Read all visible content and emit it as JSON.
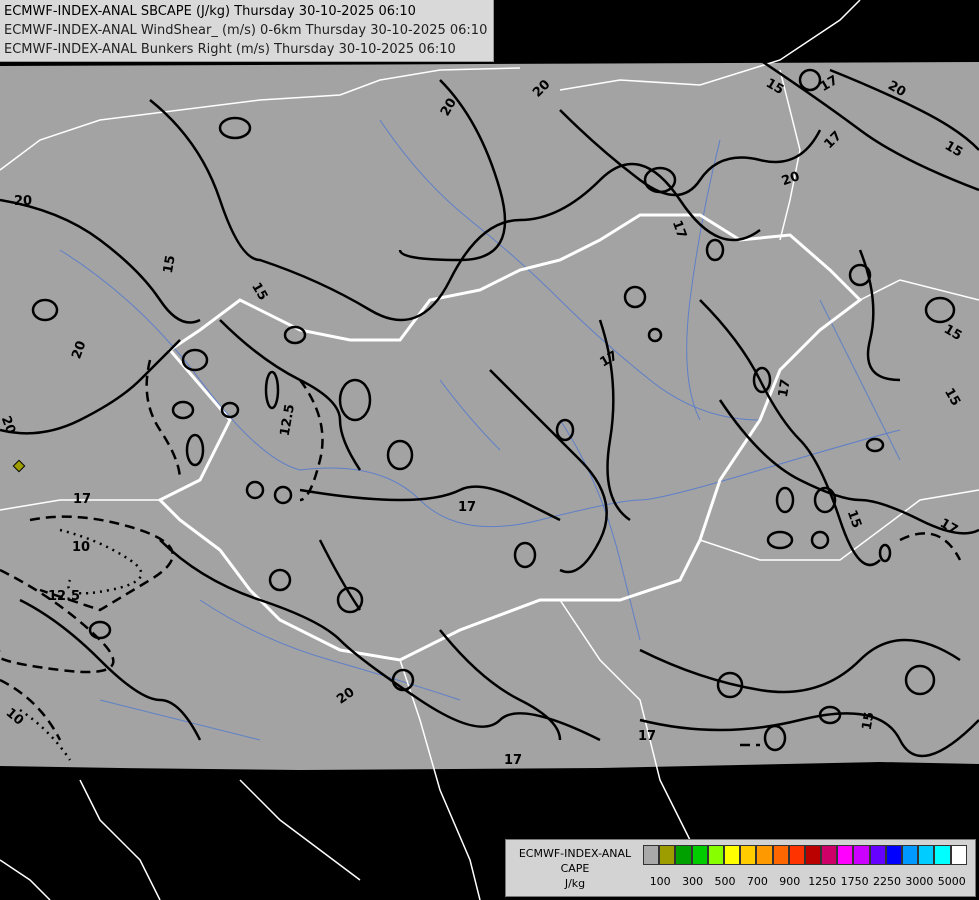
{
  "header": {
    "line1": "ECMWF-INDEX-ANAL SBCAPE (J/kg) Thursday 30-10-2025 06:10",
    "line2": "ECMWF-INDEX-ANAL WindShear_ (m/s) 0-6km Thursday 30-10-2025 06:10",
    "line3": "ECMWF-INDEX-ANAL Bunkers Right (m/s) Thursday 30-10-2025 06:10"
  },
  "contour_labels": [
    "20",
    "20",
    "20",
    "20",
    "20",
    "20",
    "20",
    "20",
    "17",
    "17",
    "17",
    "17",
    "17",
    "17",
    "17",
    "17",
    "17",
    "17",
    "15",
    "15",
    "15",
    "15",
    "15",
    "15",
    "15",
    "15",
    "12.5",
    "12.5",
    "10",
    "10"
  ],
  "legend": {
    "title1": "ECMWF-INDEX-ANAL",
    "title2": "CAPE",
    "unit": "J/kg",
    "colors": [
      "#a9a9a9",
      "#9d9d00",
      "#00a000",
      "#00cc00",
      "#88ff00",
      "#ffff00",
      "#ffcc00",
      "#ff9900",
      "#ff6600",
      "#ff3300",
      "#bb0000",
      "#cc0066",
      "#ff00ff",
      "#cc00ff",
      "#6600ff",
      "#0000ff",
      "#0099ff",
      "#00ccff",
      "#00ffff",
      "#ffffff"
    ],
    "tick_labels": [
      "100",
      "300",
      "500",
      "700",
      "900",
      "1250",
      "1750",
      "2250",
      "3000",
      "5000"
    ]
  }
}
